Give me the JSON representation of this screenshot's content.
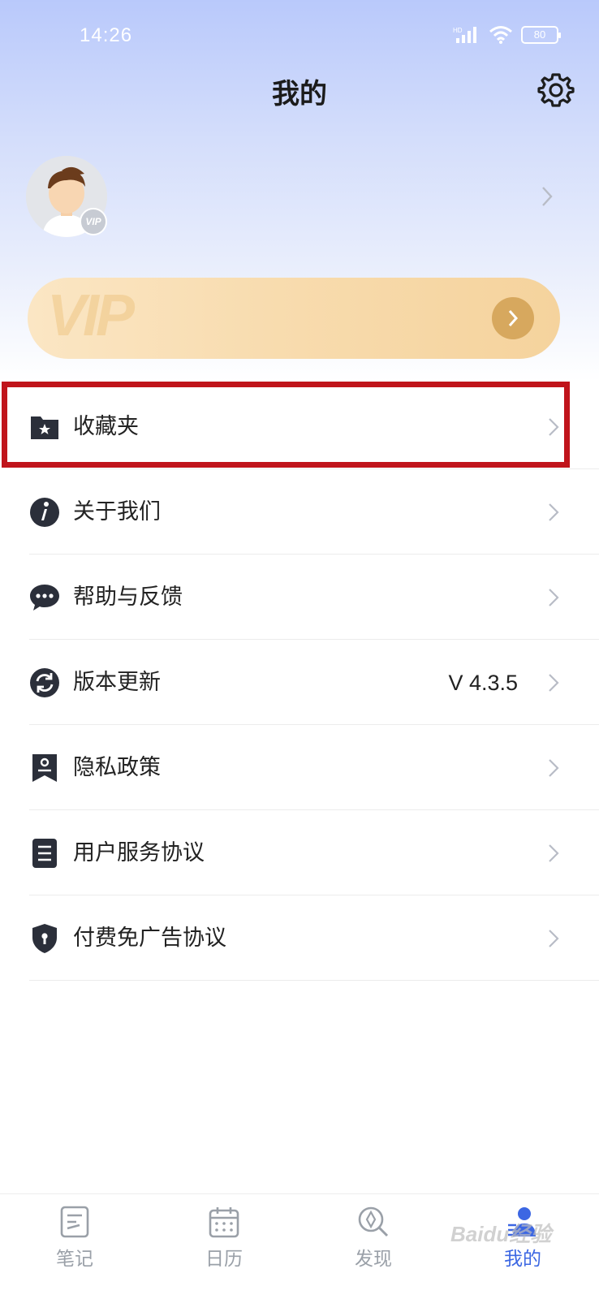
{
  "status_bar": {
    "time": "14:26",
    "battery": "80",
    "network": "HD"
  },
  "header": {
    "title": "我的"
  },
  "profile": {
    "vip_badge": "VIP"
  },
  "vip_banner": {
    "watermark": "VIP"
  },
  "menu": {
    "items": [
      {
        "label": "收藏夹",
        "icon": "favorites-folder-icon"
      },
      {
        "label": "关于我们",
        "icon": "info-icon"
      },
      {
        "label": "帮助与反馈",
        "icon": "chat-bubble-icon"
      },
      {
        "label": "版本更新",
        "icon": "refresh-icon",
        "value": "V 4.3.5"
      },
      {
        "label": "隐私政策",
        "icon": "privacy-badge-icon"
      },
      {
        "label": "用户服务协议",
        "icon": "document-icon"
      },
      {
        "label": "付费免广告协议",
        "icon": "shield-lock-icon"
      }
    ]
  },
  "tabs": [
    {
      "label": "笔记",
      "icon": "note-icon"
    },
    {
      "label": "日历",
      "icon": "calendar-icon"
    },
    {
      "label": "发现",
      "icon": "discover-icon"
    },
    {
      "label": "我的",
      "icon": "profile-icon",
      "active": true
    }
  ],
  "watermark": "Baidu经验",
  "colors": {
    "accent": "#3c67e3",
    "highlight_border": "#c0141b",
    "vip_gold": "#d7a85e"
  }
}
